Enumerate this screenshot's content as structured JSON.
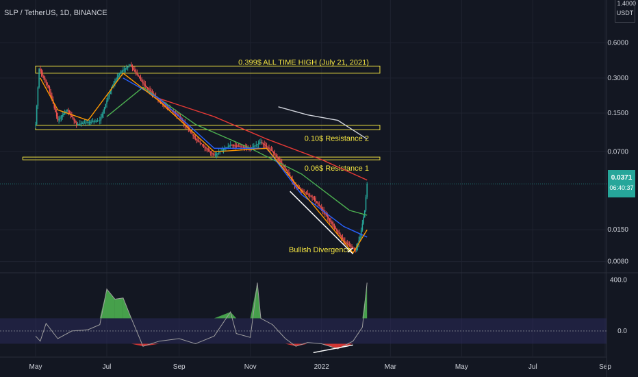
{
  "header": {
    "symbol_title": "SLP / TetherUS, 1D, BINANCE",
    "quote_currency": "USDT",
    "top_tick": "1.4000"
  },
  "last_price": {
    "value": "0.0371",
    "countdown": "06:40:37",
    "color": "#26a69a"
  },
  "colors": {
    "background": "#131722",
    "grid": "#1f2330",
    "text": "#d1d4dc",
    "annotation": "#f5e642",
    "bull": "#26a69a",
    "bear": "#ef5350",
    "ma_red": "#e53935",
    "ma_green": "#4caf50",
    "ma_blue": "#2962ff",
    "ma_orange": "#ff9800",
    "ma_white": "#d1d4dc",
    "osc_line": "#9e9e9e",
    "osc_green": "#4caf50",
    "osc_red": "#e53935",
    "osc_band": "#2a2a5a"
  },
  "chart_data": [
    {
      "type": "candlestick",
      "y_scale": "log",
      "ylim": [
        0.0065,
        1.4
      ],
      "x_tick_labels": [
        "May",
        "Jul",
        "Sep",
        "Nov",
        "2022",
        "Mar",
        "May",
        "Jul",
        "Sep"
      ],
      "y_tick_labels": [
        "0.6000",
        "0.3000",
        "0.1500",
        "0.0700",
        "0.0150",
        "0.0080"
      ],
      "y_tick_values": [
        0.6,
        0.3,
        0.15,
        0.07,
        0.015,
        0.008
      ],
      "price_path": [
        {
          "date": "2021-05-01",
          "close": 0.12
        },
        {
          "date": "2021-05-04",
          "close": 0.36
        },
        {
          "date": "2021-05-12",
          "close": 0.25
        },
        {
          "date": "2021-05-20",
          "close": 0.13
        },
        {
          "date": "2021-05-28",
          "close": 0.16
        },
        {
          "date": "2021-06-05",
          "close": 0.12
        },
        {
          "date": "2021-06-15",
          "close": 0.125
        },
        {
          "date": "2021-06-25",
          "close": 0.13
        },
        {
          "date": "2021-07-05",
          "close": 0.25
        },
        {
          "date": "2021-07-12",
          "close": 0.33
        },
        {
          "date": "2021-07-21",
          "close": 0.39
        },
        {
          "date": "2021-08-01",
          "close": 0.27
        },
        {
          "date": "2021-08-15",
          "close": 0.19
        },
        {
          "date": "2021-09-01",
          "close": 0.14
        },
        {
          "date": "2021-09-15",
          "close": 0.09
        },
        {
          "date": "2021-10-01",
          "close": 0.065
        },
        {
          "date": "2021-10-15",
          "close": 0.08
        },
        {
          "date": "2021-11-01",
          "close": 0.075
        },
        {
          "date": "2021-11-10",
          "close": 0.085
        },
        {
          "date": "2021-11-20",
          "close": 0.07
        },
        {
          "date": "2021-12-01",
          "close": 0.05
        },
        {
          "date": "2021-12-10",
          "close": 0.035
        },
        {
          "date": "2021-12-25",
          "close": 0.028
        },
        {
          "date": "2022-01-05",
          "close": 0.02
        },
        {
          "date": "2022-01-20",
          "close": 0.012
        },
        {
          "date": "2022-01-30",
          "close": 0.01
        },
        {
          "date": "2022-02-03",
          "close": 0.013
        },
        {
          "date": "2022-02-07",
          "close": 0.022
        },
        {
          "date": "2022-02-09",
          "close": 0.0371
        }
      ],
      "horizontal_zones": [
        {
          "label": "0.399$ ALL TIME HIGH (July 21, 2021)",
          "low": 0.33,
          "high": 0.38
        },
        {
          "label": "0.10$ Resistance 2",
          "low": 0.108,
          "high": 0.118
        },
        {
          "label": "0.06$ Resistance 1",
          "low": 0.06,
          "high": 0.063
        }
      ],
      "annotation": "Bullish Divergence",
      "divergence_line": [
        {
          "date": "2021-12-05",
          "price": 0.032
        },
        {
          "date": "2022-01-28",
          "price": 0.0093
        }
      ],
      "moving_averages": [
        {
          "color": "red",
          "points": [
            {
              "date": "2021-08-15",
              "value": 0.2
            },
            {
              "date": "2021-10-01",
              "value": 0.14
            },
            {
              "date": "2021-11-15",
              "value": 0.09
            },
            {
              "date": "2022-01-01",
              "value": 0.06
            },
            {
              "date": "2022-02-09",
              "value": 0.04
            }
          ]
        },
        {
          "color": "green",
          "points": [
            {
              "date": "2021-07-01",
              "value": 0.14
            },
            {
              "date": "2021-08-01",
              "value": 0.25
            },
            {
              "date": "2021-09-15",
              "value": 0.12
            },
            {
              "date": "2021-11-01",
              "value": 0.075
            },
            {
              "date": "2021-12-15",
              "value": 0.045
            },
            {
              "date": "2022-01-25",
              "value": 0.022
            },
            {
              "date": "2022-02-09",
              "value": 0.02
            }
          ]
        },
        {
          "color": "blue",
          "points": [
            {
              "date": "2021-07-15",
              "value": 0.3
            },
            {
              "date": "2021-08-15",
              "value": 0.2
            },
            {
              "date": "2021-10-01",
              "value": 0.075
            },
            {
              "date": "2021-11-15",
              "value": 0.075
            },
            {
              "date": "2021-12-15",
              "value": 0.03
            },
            {
              "date": "2022-01-20",
              "value": 0.016
            },
            {
              "date": "2022-02-09",
              "value": 0.013
            }
          ]
        },
        {
          "color": "orange",
          "points": [
            {
              "date": "2021-05-05",
              "value": 0.3
            },
            {
              "date": "2021-05-20",
              "value": 0.16
            },
            {
              "date": "2021-06-15",
              "value": 0.13
            },
            {
              "date": "2021-07-15",
              "value": 0.33
            },
            {
              "date": "2021-08-15",
              "value": 0.19
            },
            {
              "date": "2021-10-01",
              "value": 0.07
            },
            {
              "date": "2021-11-15",
              "value": 0.075
            },
            {
              "date": "2021-12-20",
              "value": 0.028
            },
            {
              "date": "2022-01-28",
              "value": 0.0095
            },
            {
              "date": "2022-02-09",
              "value": 0.015
            }
          ]
        },
        {
          "color": "white",
          "points": [
            {
              "date": "2021-11-25",
              "value": 0.17
            },
            {
              "date": "2021-12-20",
              "value": 0.145
            },
            {
              "date": "2022-01-15",
              "value": 0.13
            },
            {
              "date": "2022-02-09",
              "value": 0.09
            }
          ]
        }
      ]
    },
    {
      "type": "area",
      "ylim": [
        -200,
        420
      ],
      "y_tick_labels": [
        "400.0",
        "0.0"
      ],
      "y_tick_values": [
        400,
        0
      ],
      "band": [
        -100,
        100
      ],
      "values": [
        {
          "date": "2021-05-01",
          "value": -40
        },
        {
          "date": "2021-05-05",
          "value": -80
        },
        {
          "date": "2021-05-10",
          "value": 60
        },
        {
          "date": "2021-05-20",
          "value": -60
        },
        {
          "date": "2021-06-01",
          "value": 0
        },
        {
          "date": "2021-06-15",
          "value": 10
        },
        {
          "date": "2021-06-25",
          "value": 50
        },
        {
          "date": "2021-07-01",
          "value": 330
        },
        {
          "date": "2021-07-08",
          "value": 250
        },
        {
          "date": "2021-07-15",
          "value": 260
        },
        {
          "date": "2021-07-22",
          "value": 100
        },
        {
          "date": "2021-08-01",
          "value": -120
        },
        {
          "date": "2021-08-15",
          "value": -80
        },
        {
          "date": "2021-09-01",
          "value": -60
        },
        {
          "date": "2021-09-15",
          "value": -100
        },
        {
          "date": "2021-10-01",
          "value": -40
        },
        {
          "date": "2021-10-15",
          "value": 150
        },
        {
          "date": "2021-10-20",
          "value": -20
        },
        {
          "date": "2021-11-01",
          "value": -50
        },
        {
          "date": "2021-11-07",
          "value": 380
        },
        {
          "date": "2021-11-10",
          "value": 100
        },
        {
          "date": "2021-11-20",
          "value": 50
        },
        {
          "date": "2021-12-01",
          "value": -60
        },
        {
          "date": "2021-12-10",
          "value": -120
        },
        {
          "date": "2021-12-20",
          "value": -90
        },
        {
          "date": "2022-01-01",
          "value": -100
        },
        {
          "date": "2022-01-15",
          "value": -140
        },
        {
          "date": "2022-01-28",
          "value": -80
        },
        {
          "date": "2022-02-05",
          "value": 30
        },
        {
          "date": "2022-02-09",
          "value": 380
        }
      ],
      "divergence_line": [
        {
          "date": "2021-12-25",
          "value": -170
        },
        {
          "date": "2022-01-28",
          "value": -110
        }
      ]
    }
  ]
}
